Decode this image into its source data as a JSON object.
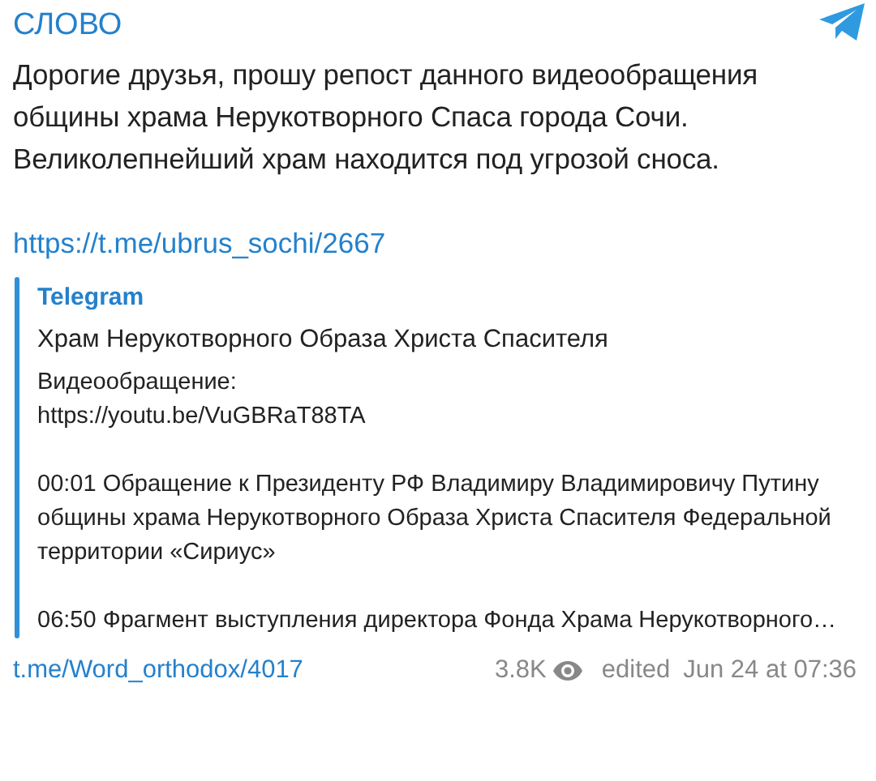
{
  "channel": {
    "name": "СЛОВО"
  },
  "message": {
    "text": "Дорогие друзья, прошу репост данного видеообращения общины храма Нерукотворного Спаса города Сочи. Великолепнейший храм находится под угрозой сноса.",
    "link": "https://t.me/ubrus_sochi/2667"
  },
  "preview": {
    "site": "Telegram",
    "title": "Храм Нерукотворного Образа Христа Спасителя",
    "paragraphs": [
      "Видеообращение:\nhttps://youtu.be/VuGBRaT88TA",
      "00:01 Обращение к Президенту РФ Владимиру Владимировичу Путину общины храма Нерукотворного Образа Христа Спасителя Федеральной территории «Сириус»",
      "06:50 Фрагмент выступления директора Фонда Храма Нерукотворного…"
    ]
  },
  "footer": {
    "post_link": "t.me/Word_orthodox/4017",
    "views": "3.8K",
    "edited": "edited",
    "date": "Jun 24 at 07:36"
  }
}
